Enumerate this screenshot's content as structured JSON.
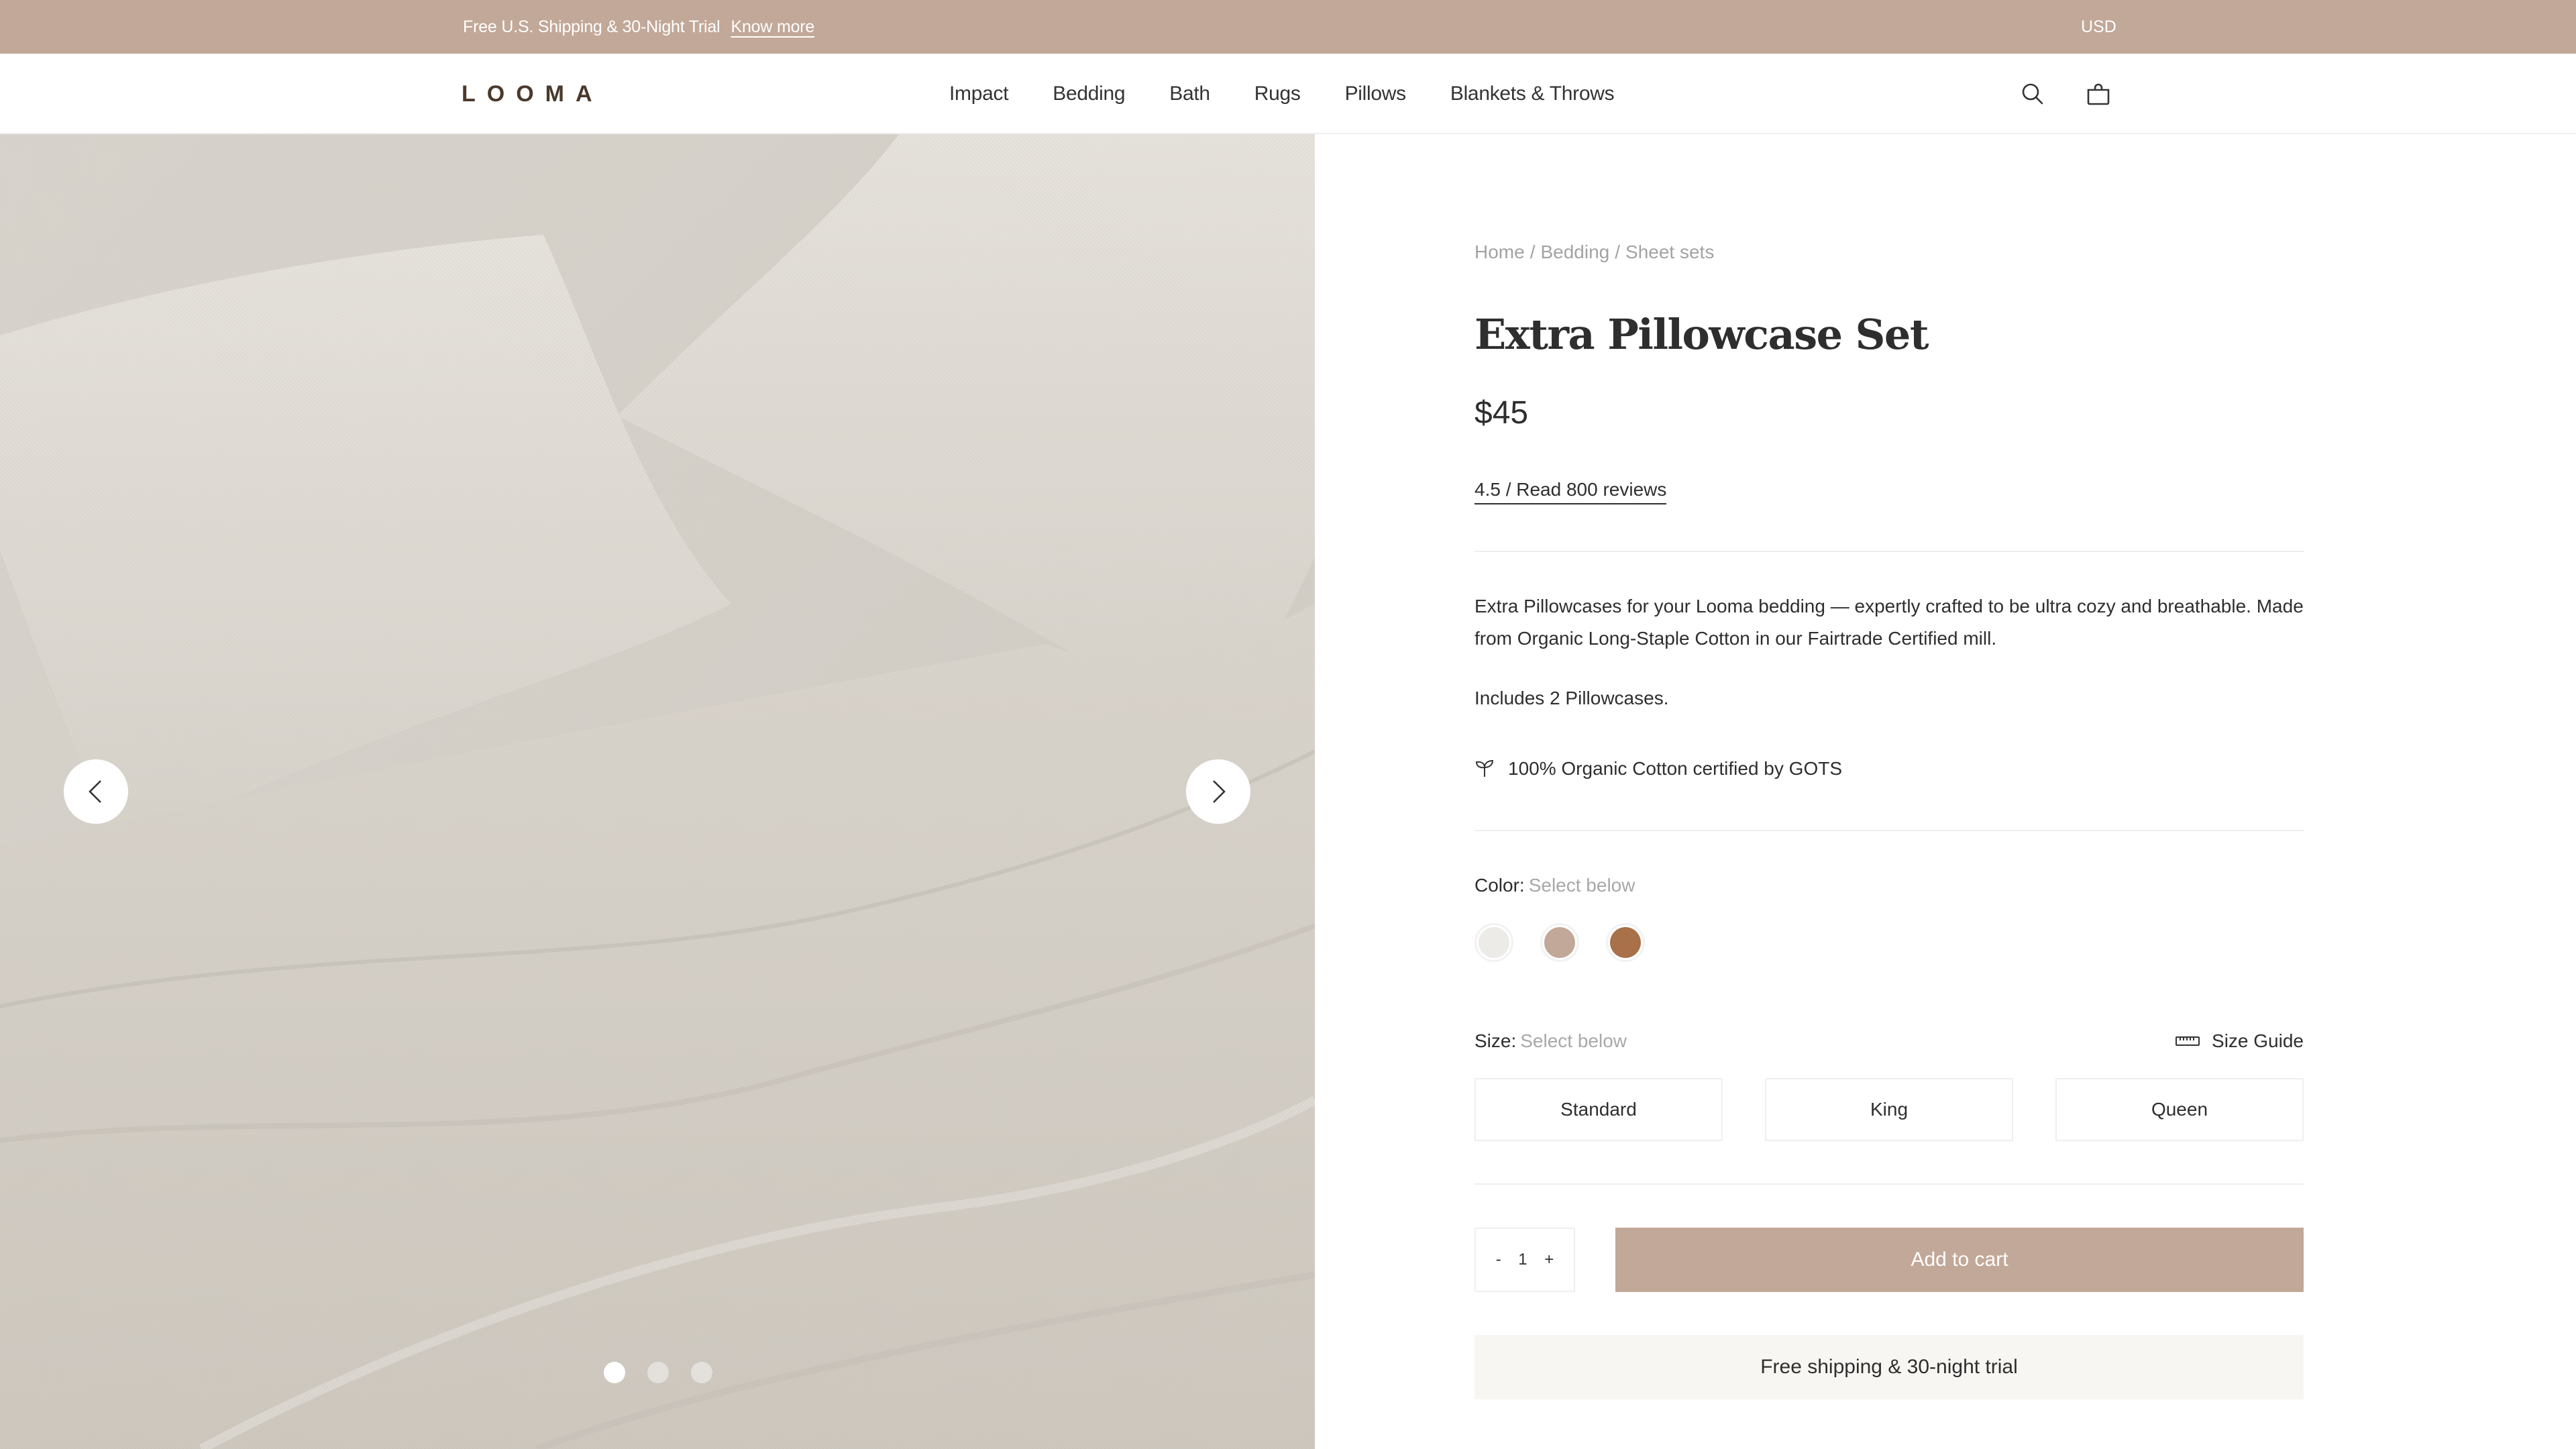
{
  "announcement": {
    "promo_text": "Free U.S. Shipping & 30-Night Trial",
    "promo_link": "Know more",
    "currency": "USD"
  },
  "header": {
    "logo": "LOOMA",
    "nav": [
      "Impact",
      "Bedding",
      "Bath",
      "Rugs",
      "Pillows",
      "Blankets & Throws"
    ],
    "icons": [
      "search-icon",
      "shopping-bag-icon"
    ]
  },
  "gallery": {
    "image_alt": "Linen pillowcases and sheets on a bed",
    "slide_count": 3,
    "active_slide": 1,
    "prev_icon": "chevron-left-icon",
    "next_icon": "chevron-right-icon"
  },
  "product": {
    "breadcrumb": [
      "Home",
      "Bedding",
      "Sheet sets"
    ],
    "breadcrumb_sep": "/",
    "title": "Extra Pillowcase Set",
    "price": "$45",
    "reviews": "4.5 / Read 800 reviews",
    "description": "Extra Pillowcases for your Looma bedding — expertly crafted to be ultra cozy and breathable. Made from Organic Long-Staple Cotton in our Fairtrade Certified mill.",
    "includes": "Includes 2 Pillowcases.",
    "certification": "100% Organic Cotton certified by GOTS",
    "color": {
      "label": "Color:",
      "hint": "Select below",
      "swatches": [
        "#ECEBE7",
        "#C2A898",
        "#A8714A"
      ]
    },
    "size": {
      "label": "Size:",
      "hint": "Select below",
      "guide": "Size Guide",
      "options": [
        "Standard",
        "King",
        "Queen"
      ]
    },
    "quantity": {
      "minus": "-",
      "value": "1",
      "plus": "+"
    },
    "add_to_cart": "Add to cart",
    "shipping_note": "Free shipping & 30-night trial"
  },
  "colors": {
    "accent": "#C2A898",
    "text": "#2E2E2E",
    "muted": "#A3A3A3",
    "banner_bg": "#F8F6F2"
  }
}
